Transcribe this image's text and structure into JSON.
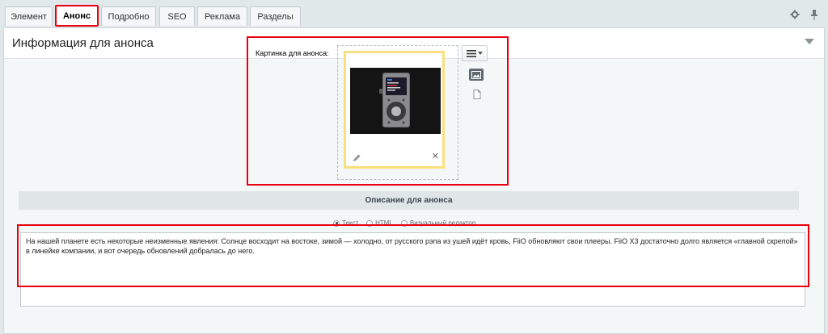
{
  "tabs": [
    {
      "label": "Элемент",
      "active": false
    },
    {
      "label": "Анонс",
      "active": true
    },
    {
      "label": "Подробно",
      "active": false
    },
    {
      "label": "SEO",
      "active": false
    },
    {
      "label": "Реклама",
      "active": false
    },
    {
      "label": "Разделы",
      "active": false
    }
  ],
  "panel": {
    "title": "Информация для анонса"
  },
  "picture": {
    "label": "Картинка для анонса:"
  },
  "description": {
    "section_title": "Описание для анонса",
    "modes": [
      {
        "label": "Текст",
        "selected": true
      },
      {
        "label": "HTML",
        "selected": false
      },
      {
        "label": "Визуальный редактор",
        "selected": false
      }
    ],
    "text": "На нашей планете есть некоторые неизменные явления: Солнце восходит на востоке, зимой — холодно, от русского рэпа из ушей идёт кровь, FiiO обновляют свои плееры. FiiO X3 достаточно долго является «главной скрепой» в линейке компании, и вот очередь обновлений добралась до него."
  },
  "icons": {
    "settings": "gear-icon",
    "pin": "pin-icon",
    "edit": "pencil-icon",
    "remove": "close-icon",
    "menu": "menu-icon",
    "image": "image-icon",
    "file": "file-icon"
  },
  "colors": {
    "highlight": "#e8000f",
    "card_border": "#f8e07e",
    "background": "#e0e8ea"
  }
}
